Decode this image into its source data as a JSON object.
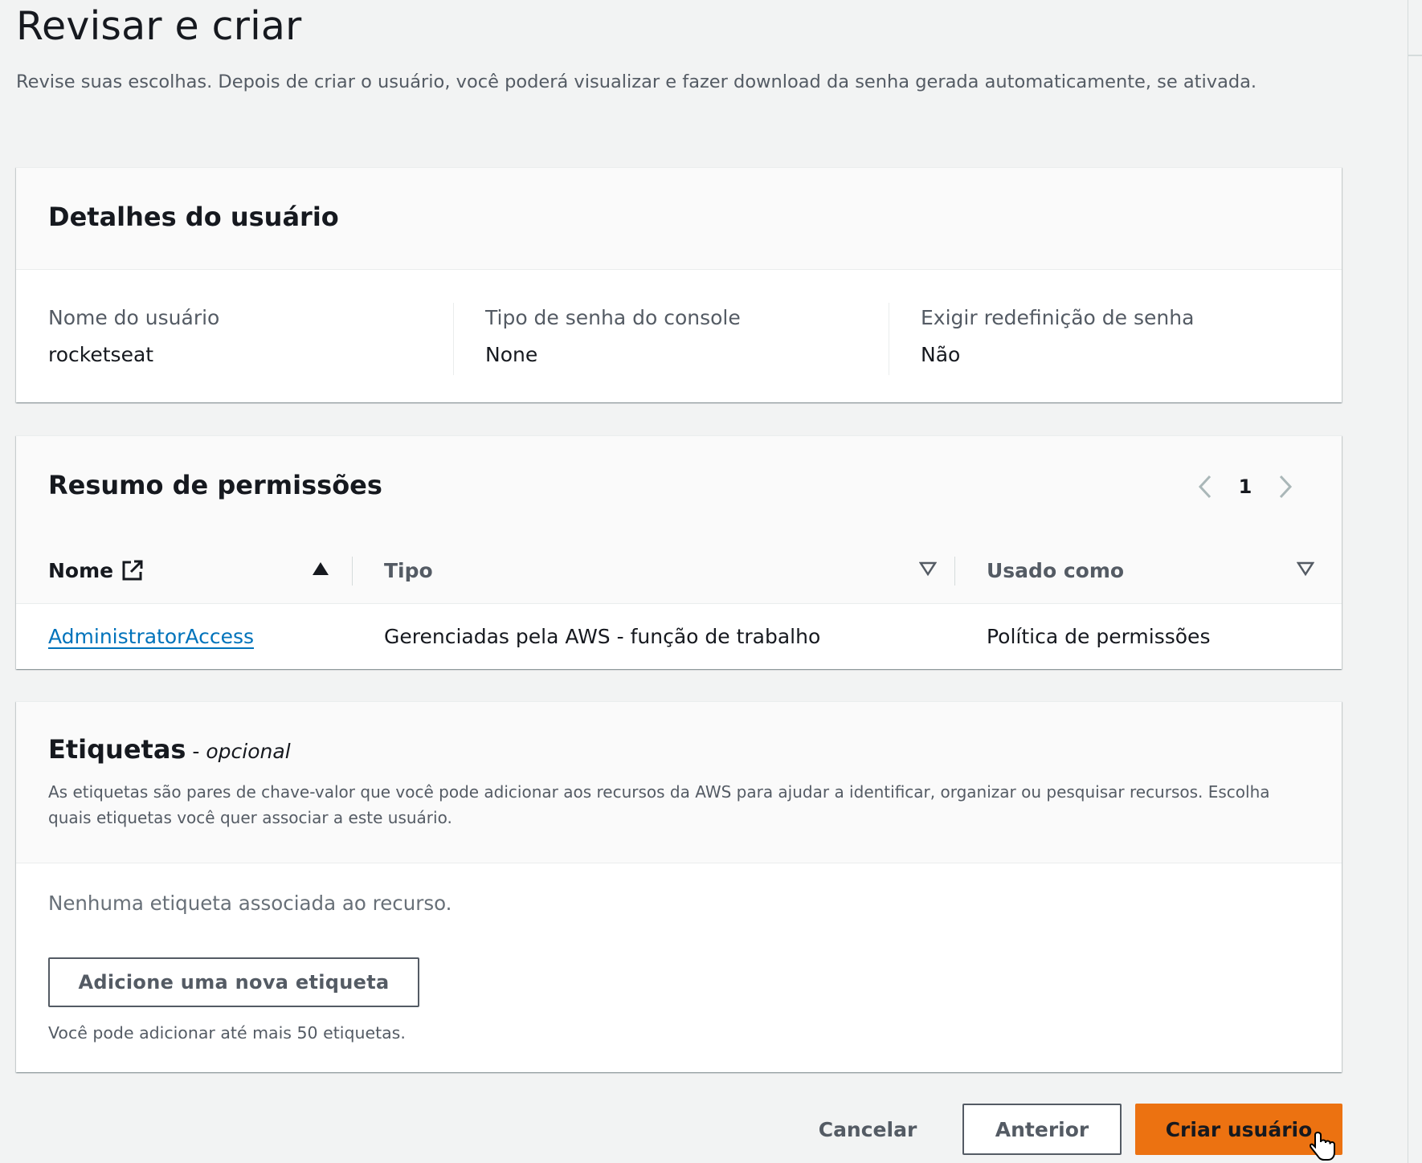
{
  "page": {
    "title": "Revisar e criar",
    "description": "Revise suas escolhas. Depois de criar o usuário, você poderá visualizar e fazer download da senha gerada automaticamente, se ativada."
  },
  "user_details": {
    "title": "Detalhes do usuário",
    "fields": [
      {
        "label": "Nome do usuário",
        "value": "rocketseat"
      },
      {
        "label": "Tipo de senha do console",
        "value": "None"
      },
      {
        "label": "Exigir redefinição de senha",
        "value": "Não"
      }
    ]
  },
  "permissions": {
    "title": "Resumo de permissões",
    "page_number": "1",
    "columns": [
      {
        "label": "Nome",
        "sort": "ascending",
        "icon": "external-link-icon"
      },
      {
        "label": "Tipo",
        "sort": "unsorted"
      },
      {
        "label": "Usado como",
        "sort": "unsorted"
      }
    ],
    "rows": [
      {
        "name": "AdministratorAccess",
        "type": "Gerenciadas pela AWS - função de trabalho",
        "used_as": "Política de permissões"
      }
    ]
  },
  "tags": {
    "title": "Etiquetas",
    "optional_dash": " - ",
    "optional_label": "opcional",
    "description": "As etiquetas são pares de chave-valor que você pode adicionar aos recursos da AWS para ajudar a identificar, organizar ou pesquisar recursos. Escolha quais etiquetas você quer associar a este usuário.",
    "empty_text": "Nenhuma etiqueta associada ao recurso.",
    "add_button": "Adicione uma nova etiqueta",
    "hint": "Você pode adicionar até mais 50 etiquetas."
  },
  "footer": {
    "cancel": "Cancelar",
    "previous": "Anterior",
    "create": "Criar usuário"
  },
  "colors": {
    "primary_button": "#ec7211",
    "link": "#0073bb",
    "text": "#16191f",
    "secondary_text": "#545b64",
    "page_bg": "#f2f3f3"
  }
}
